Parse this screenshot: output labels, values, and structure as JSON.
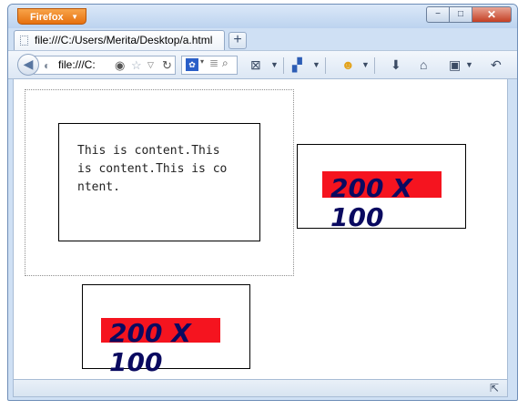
{
  "window": {
    "app_button_label": "Firefox",
    "controls": {
      "minimize": "−",
      "maximize": "□",
      "close": "✕"
    }
  },
  "tab": {
    "title": "file:///C:/Users/Merita/Desktop/a.html",
    "new_tab_label": "+"
  },
  "navbar": {
    "url_display": "file:///C:",
    "icons": [
      "back-icon",
      "globe-icon",
      "identity-icon",
      "bookmark-star-icon",
      "history-dropdown-icon",
      "reload-icon",
      "search-engine-icon",
      "search-icon",
      "screenshot-icon",
      "addon-icon",
      "emoji-icon",
      "download-icon",
      "home-icon",
      "bookmarks-menu-icon",
      "undo-icon"
    ]
  },
  "page": {
    "paragraph": "This is content.This is content.This is content.",
    "box_label_1": "200 X 100",
    "box_label_2": "200 X 100",
    "colors": {
      "red_bar": "#f5141f",
      "label_text": "#0a0a60",
      "dotted_border": "#8f8f8f"
    }
  }
}
